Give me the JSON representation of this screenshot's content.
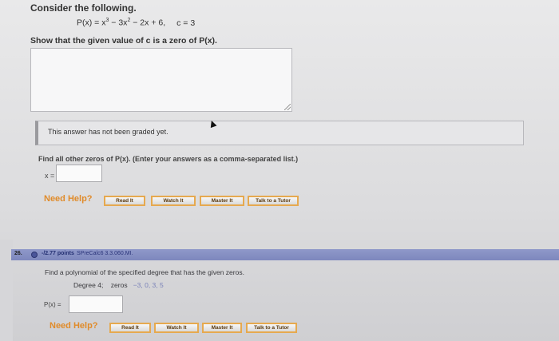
{
  "question1": {
    "title": "Consider the following.",
    "polynomial_lhs": "P(x) = x",
    "exp3": "3",
    "minus3x": " − 3x",
    "exp2": "2",
    "rest": " − 2x + 6,",
    "c_value": "c = 3",
    "show_that": "Show that the given value of c is a zero of P(x).",
    "graded_status": "This answer has not been graded yet.",
    "find_zeros": "Find all other zeros of P(x). (Enter your answers as a comma-separated list.)",
    "x_label": "x =",
    "x_value": "",
    "need_help": "Need Help?",
    "buttons": [
      "Read It",
      "Watch It",
      "Master It",
      "Talk to a Tutor"
    ]
  },
  "question2": {
    "number": "26.",
    "points": "-/2.77 points",
    "source": "SPreCalc6 3.3.060.MI.",
    "prompt": "Find a polynomial of the specified degree that has the given zeros.",
    "degree": "Degree 4;",
    "zeros_label": "zeros",
    "zeros": "−3, 0, 3, 5",
    "p_label": "P(x) =",
    "p_value": "",
    "need_help": "Need Help?",
    "buttons": [
      "Read It",
      "Watch It",
      "Master It",
      "Talk to a Tutor"
    ]
  },
  "colors": {
    "accent_orange": "#e08b2a",
    "divider_blue": "#8f98c9"
  }
}
